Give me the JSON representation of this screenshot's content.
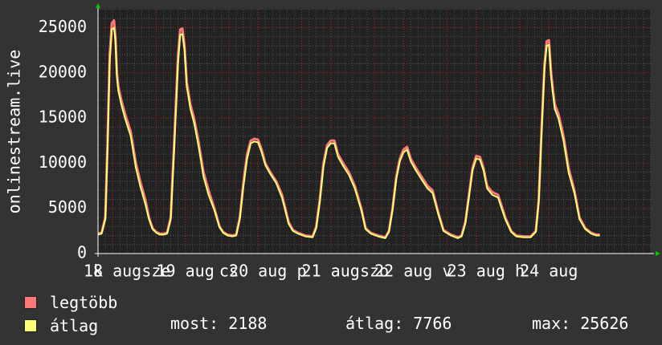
{
  "chart_data": {
    "type": "line",
    "ylabel": "onlinestream.live",
    "ylim": [
      0,
      27000
    ],
    "yticks": [
      0,
      5000,
      10000,
      15000,
      20000,
      25000
    ],
    "xlim": [
      0,
      7.6
    ],
    "xticks": [
      {
        "x": 0.0,
        "label": "k"
      },
      {
        "x": 0.2,
        "label": "18 aug"
      },
      {
        "x": 0.8,
        "label": "sze"
      },
      {
        "x": 1.2,
        "label": "19 aug"
      },
      {
        "x": 1.8,
        "label": "cs"
      },
      {
        "x": 2.2,
        "label": "20 aug"
      },
      {
        "x": 2.8,
        "label": "p"
      },
      {
        "x": 3.2,
        "label": "21 aug"
      },
      {
        "x": 3.8,
        "label": "szo"
      },
      {
        "x": 4.2,
        "label": "22 aug"
      },
      {
        "x": 4.8,
        "label": "v"
      },
      {
        "x": 5.2,
        "label": "23 aug"
      },
      {
        "x": 5.8,
        "label": "h"
      },
      {
        "x": 6.2,
        "label": "24 aug"
      }
    ],
    "grid": true,
    "series": [
      {
        "name": "legtöbb",
        "color": "#ff7777",
        "x": [
          0.0,
          0.05,
          0.1,
          0.13,
          0.16,
          0.19,
          0.22,
          0.24,
          0.26,
          0.28,
          0.32,
          0.37,
          0.45,
          0.52,
          0.58,
          0.65,
          0.7,
          0.75,
          0.8,
          0.85,
          0.9,
          0.95,
          1.0,
          1.05,
          1.1,
          1.13,
          1.16,
          1.19,
          1.22,
          1.24,
          1.27,
          1.32,
          1.38,
          1.45,
          1.52,
          1.6,
          1.67,
          1.72,
          1.78,
          1.85,
          1.9,
          1.95,
          2.0,
          2.05,
          2.1,
          2.15,
          2.2,
          2.25,
          2.3,
          2.37,
          2.45,
          2.53,
          2.62,
          2.68,
          2.75,
          2.85,
          2.95,
          3.0,
          3.05,
          3.1,
          3.15,
          3.2,
          3.25,
          3.3,
          3.37,
          3.45,
          3.53,
          3.62,
          3.68,
          3.75,
          3.85,
          3.95,
          4.0,
          4.05,
          4.1,
          4.15,
          4.2,
          4.25,
          4.3,
          4.37,
          4.45,
          4.53,
          4.6,
          4.68,
          4.75,
          4.85,
          4.95,
          5.0,
          5.05,
          5.1,
          5.15,
          5.2,
          5.25,
          5.3,
          5.35,
          5.42,
          5.5,
          5.6,
          5.68,
          5.75,
          5.85,
          5.95,
          6.02,
          6.06,
          6.1,
          6.14,
          6.17,
          6.2,
          6.23,
          6.25,
          6.28,
          6.33,
          6.4,
          6.47,
          6.55,
          6.62,
          6.7,
          6.78,
          6.85,
          6.9
        ],
        "values": [
          2200,
          2300,
          4000,
          12000,
          22000,
          25500,
          25800,
          24000,
          20000,
          18500,
          17000,
          15500,
          13500,
          10000,
          8000,
          6000,
          4000,
          2800,
          2400,
          2200,
          2200,
          2300,
          4000,
          13000,
          22000,
          24800,
          24900,
          23000,
          19000,
          18000,
          16500,
          15000,
          12500,
          9000,
          7000,
          5000,
          3000,
          2400,
          2100,
          2000,
          2100,
          4000,
          8000,
          11000,
          12500,
          12700,
          12600,
          11500,
          10000,
          9000,
          8000,
          6500,
          3500,
          2600,
          2300,
          2000,
          1900,
          3000,
          6000,
          10000,
          12000,
          12500,
          12500,
          11000,
          10000,
          9000,
          7500,
          5000,
          2800,
          2300,
          2000,
          1800,
          2500,
          5000,
          8500,
          10500,
          11500,
          11800,
          10500,
          9500,
          8500,
          7500,
          7000,
          4500,
          2600,
          2100,
          1800,
          2000,
          3500,
          6500,
          9500,
          10800,
          10700,
          9500,
          7500,
          6800,
          6500,
          4000,
          2500,
          2000,
          1900,
          1900,
          2500,
          6000,
          14000,
          21000,
          23500,
          23600,
          20000,
          18500,
          16500,
          15500,
          13000,
          9500,
          7000,
          4000,
          2800,
          2300,
          2100,
          2100
        ]
      },
      {
        "name": "átlag",
        "color": "#ffff77",
        "x": [
          0.0,
          0.05,
          0.1,
          0.13,
          0.16,
          0.19,
          0.22,
          0.24,
          0.26,
          0.28,
          0.32,
          0.37,
          0.45,
          0.52,
          0.58,
          0.65,
          0.7,
          0.75,
          0.8,
          0.85,
          0.9,
          0.95,
          1.0,
          1.05,
          1.1,
          1.13,
          1.16,
          1.19,
          1.22,
          1.24,
          1.27,
          1.32,
          1.38,
          1.45,
          1.52,
          1.6,
          1.67,
          1.72,
          1.78,
          1.85,
          1.9,
          1.95,
          2.0,
          2.05,
          2.1,
          2.15,
          2.2,
          2.25,
          2.3,
          2.37,
          2.45,
          2.53,
          2.62,
          2.68,
          2.75,
          2.85,
          2.95,
          3.0,
          3.05,
          3.1,
          3.15,
          3.2,
          3.25,
          3.3,
          3.37,
          3.45,
          3.53,
          3.62,
          3.68,
          3.75,
          3.85,
          3.95,
          4.0,
          4.05,
          4.1,
          4.15,
          4.2,
          4.25,
          4.3,
          4.37,
          4.45,
          4.53,
          4.6,
          4.68,
          4.75,
          4.85,
          4.95,
          5.0,
          5.05,
          5.1,
          5.15,
          5.2,
          5.25,
          5.3,
          5.35,
          5.42,
          5.5,
          5.6,
          5.68,
          5.75,
          5.85,
          5.95,
          6.02,
          6.06,
          6.1,
          6.14,
          6.17,
          6.2,
          6.23,
          6.25,
          6.28,
          6.33,
          6.4,
          6.47,
          6.55,
          6.62,
          6.7,
          6.78,
          6.85,
          6.9
        ],
        "values": [
          2100,
          2200,
          3800,
          11500,
          21000,
          24800,
          25000,
          23500,
          19500,
          18000,
          16500,
          15000,
          13000,
          9500,
          7500,
          5500,
          3800,
          2700,
          2300,
          2100,
          2100,
          2200,
          3800,
          12000,
          21000,
          24200,
          24300,
          22500,
          18500,
          17500,
          16000,
          14500,
          12000,
          8500,
          6500,
          4800,
          2900,
          2300,
          2000,
          1900,
          2000,
          3800,
          7500,
          10500,
          12200,
          12400,
          12300,
          11200,
          9800,
          8800,
          7800,
          6200,
          3300,
          2500,
          2200,
          1900,
          1800,
          2800,
          5700,
          9600,
          11700,
          12200,
          12200,
          10700,
          9700,
          8700,
          7200,
          4800,
          2700,
          2200,
          1900,
          1700,
          2400,
          4800,
          8200,
          10200,
          11200,
          11500,
          10200,
          9200,
          8200,
          7200,
          6700,
          4300,
          2500,
          2000,
          1700,
          1900,
          3300,
          6200,
          9200,
          10500,
          10400,
          9200,
          7200,
          6500,
          6200,
          3800,
          2400,
          1900,
          1800,
          1800,
          2400,
          5700,
          13500,
          20500,
          23000,
          23100,
          19500,
          18000,
          16000,
          15000,
          12500,
          9000,
          6700,
          3800,
          2700,
          2200,
          2000,
          2000
        ]
      }
    ]
  },
  "colors": {
    "background": "#333333",
    "plot_background": "#222222",
    "grid": "#aa2222",
    "axis": "#ffffff",
    "arrow": "#00cc00"
  },
  "stats": {
    "now": "most: 2188",
    "avg": "átlag: 7766",
    "max": "max: 25626"
  }
}
